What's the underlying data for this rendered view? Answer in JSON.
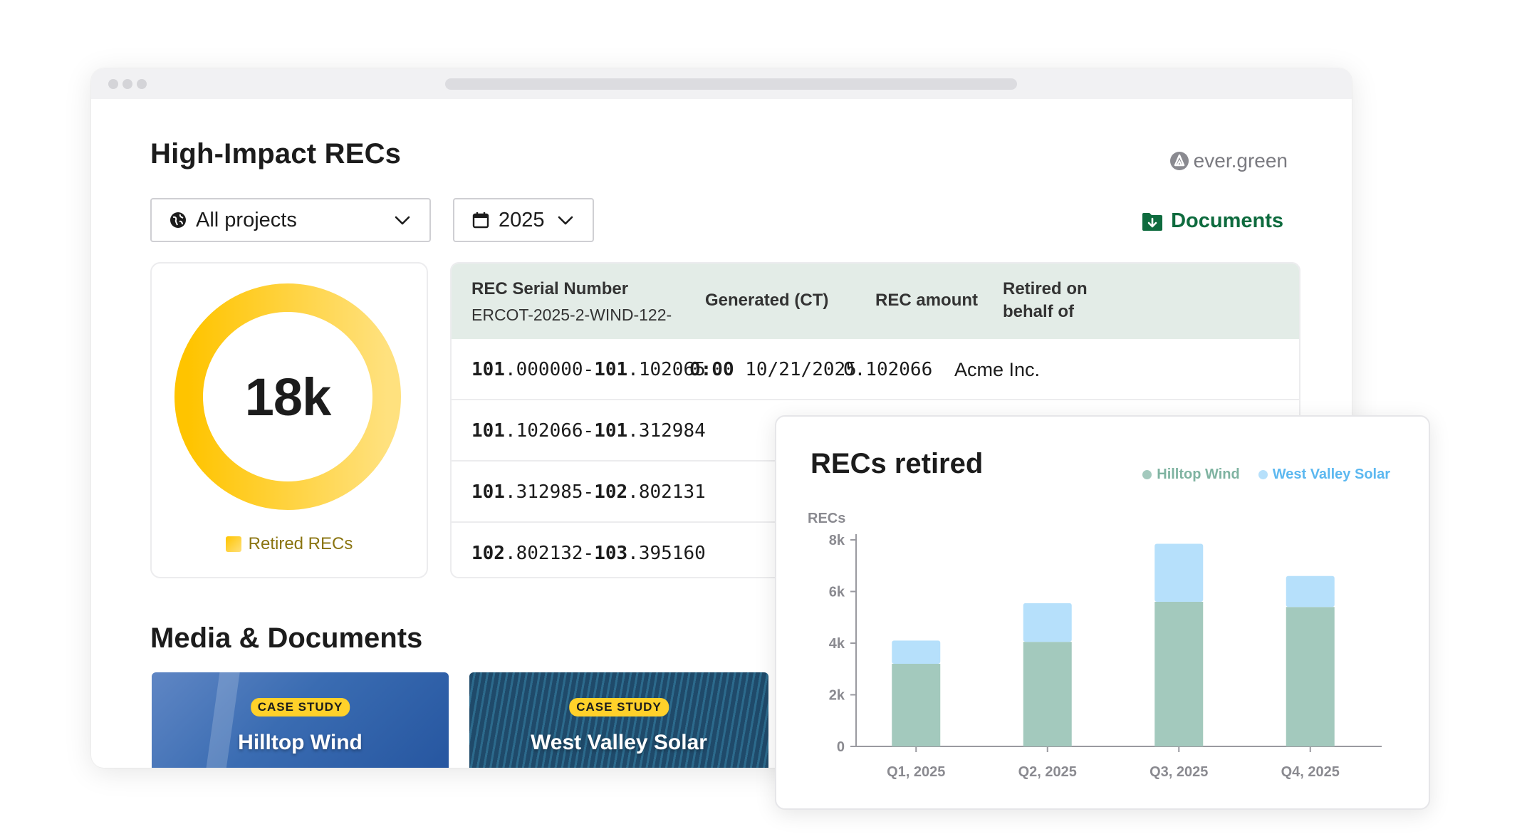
{
  "page": {
    "title": "High-Impact RECs",
    "brand": "ever.green"
  },
  "filters": {
    "project": "All projects",
    "year": "2025"
  },
  "documents_label": "Documents",
  "summary": {
    "value": "18k",
    "legend": "Retired RECs",
    "fraction": 1.0
  },
  "table": {
    "headers": {
      "serial": "REC Serial Number",
      "serial_prefix": "ERCOT-2025-2-WIND-122-",
      "generated": "Generated (CT)",
      "amount": "REC amount",
      "retired": "Retired on behalf of"
    },
    "rows": [
      {
        "a_bold": "101",
        "a": ".000000-",
        "b_bold": "101",
        "b": ".102065",
        "time": "0:00",
        "date": "10/21/2025",
        "amount": "0.102066",
        "retired": "Acme Inc."
      },
      {
        "a_bold": "101",
        "a": ".102066-",
        "b_bold": "101",
        "b": ".312984",
        "time": "",
        "date": "",
        "amount": "",
        "retired": ""
      },
      {
        "a_bold": "101",
        "a": ".312985-",
        "b_bold": "102",
        "b": ".802131",
        "time": "",
        "date": "",
        "amount": "",
        "retired": ""
      },
      {
        "a_bold": "102",
        "a": ".802132-",
        "b_bold": "103",
        "b": ".395160",
        "time": "",
        "date": "",
        "amount": "",
        "retired": ""
      }
    ]
  },
  "media": {
    "title": "Media & Documents",
    "cards": [
      {
        "badge": "CASE STUDY",
        "title": "Hilltop Wind"
      },
      {
        "badge": "CASE STUDY",
        "title": "West Valley Solar"
      }
    ]
  },
  "chart": {
    "title": "RECs retired",
    "colors": {
      "hilltop": "#a3c9bd",
      "westvalley": "#b6e0fb",
      "hilltop_text": "#7fb3a1",
      "westvalley_text": "#5cb8f0"
    }
  },
  "chart_data": {
    "type": "bar",
    "stacked": true,
    "title": "RECs retired",
    "ylabel": "RECs",
    "xlabel": "",
    "categories": [
      "Q1, 2025",
      "Q2, 2025",
      "Q3, 2025",
      "Q4, 2025"
    ],
    "series": [
      {
        "name": "Hilltop Wind",
        "values": [
          3200,
          4050,
          5600,
          5400
        ]
      },
      {
        "name": "West Valley Solar",
        "values": [
          900,
          1500,
          2250,
          1200
        ]
      }
    ],
    "ylim": [
      0,
      8000
    ],
    "yticks": [
      0,
      2000,
      4000,
      6000,
      8000
    ],
    "ytick_labels": [
      "0",
      "2k",
      "4k",
      "6k",
      "8k"
    ],
    "legend": "top-right",
    "grid": false
  }
}
